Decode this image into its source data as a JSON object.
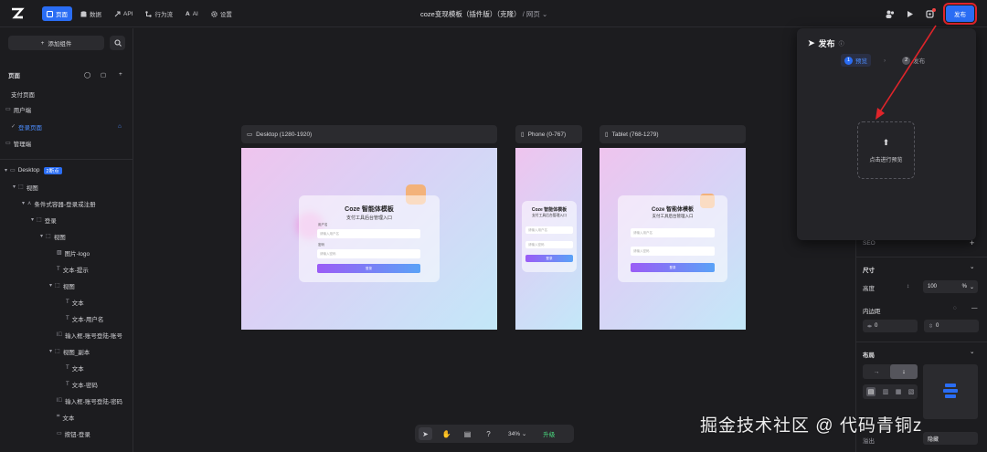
{
  "topbar": {
    "nav": [
      {
        "label": "页面",
        "icon": "page-icon",
        "active": true
      },
      {
        "label": "数据",
        "icon": "database-icon",
        "active": false
      },
      {
        "label": "API",
        "icon": "api-icon",
        "active": false
      },
      {
        "label": "行为流",
        "icon": "flow-icon",
        "active": false
      },
      {
        "label": "AI",
        "icon": "ai-icon",
        "active": false
      },
      {
        "label": "设置",
        "icon": "gear-icon",
        "active": false
      }
    ],
    "title": "coze变现模板（插件版）（克隆）",
    "title_sub": "/ 网页",
    "publish_label": "发布",
    "accent": "#2a6df4",
    "highlight": "#e0242a"
  },
  "left": {
    "add_component": "添加组件",
    "pages_title": "页面",
    "pages": [
      "支付页面",
      "用户端",
      "登录页面",
      "管理端"
    ],
    "tree": [
      {
        "label": "Desktop",
        "badge": "2断点"
      },
      {
        "label": "视图"
      },
      {
        "label": "条件式容器-登录或注册"
      },
      {
        "label": "登录"
      },
      {
        "label": "视图"
      },
      {
        "label": "图片-logo"
      },
      {
        "label": "文本-提示"
      },
      {
        "label": "视图"
      },
      {
        "label": "文本"
      },
      {
        "label": "文本-用户名"
      },
      {
        "label": "输入框-账号登陆-账号"
      },
      {
        "label": "视图_副本"
      },
      {
        "label": "文本"
      },
      {
        "label": "文本-密码"
      },
      {
        "label": "输入框-账号登陆-密码"
      },
      {
        "label": "文本"
      },
      {
        "label": "按钮-登录"
      }
    ]
  },
  "canvas": {
    "frames": [
      {
        "label": "Desktop (1280-1920)"
      },
      {
        "label": "Phone (0-767)"
      },
      {
        "label": "Tablet (768-1279)"
      }
    ],
    "card": {
      "title": "Coze 智能体模板",
      "subtitle": "支付工具后台管理入口",
      "user_label": "用户名",
      "user_placeholder": "请输入用户名",
      "pwd_label": "密码",
      "pwd_placeholder": "请输入密码",
      "button": "登录"
    },
    "zoom": "34%",
    "upgrade": "升级"
  },
  "right": {
    "seo": "SEO",
    "size_title": "尺寸",
    "height_label": "高度",
    "height_value": "100",
    "height_unit": "%",
    "padding_label": "内边距",
    "padding_x": "0",
    "padding_y": "0",
    "layout_title": "布局",
    "overflow_label": "溢出",
    "overflow_value": "隐藏"
  },
  "popup": {
    "title": "发布",
    "step1": "预览",
    "step2": "发布",
    "preview_action": "点击进行预览"
  },
  "watermark": "掘金技术社区 @ 代码青铜z"
}
